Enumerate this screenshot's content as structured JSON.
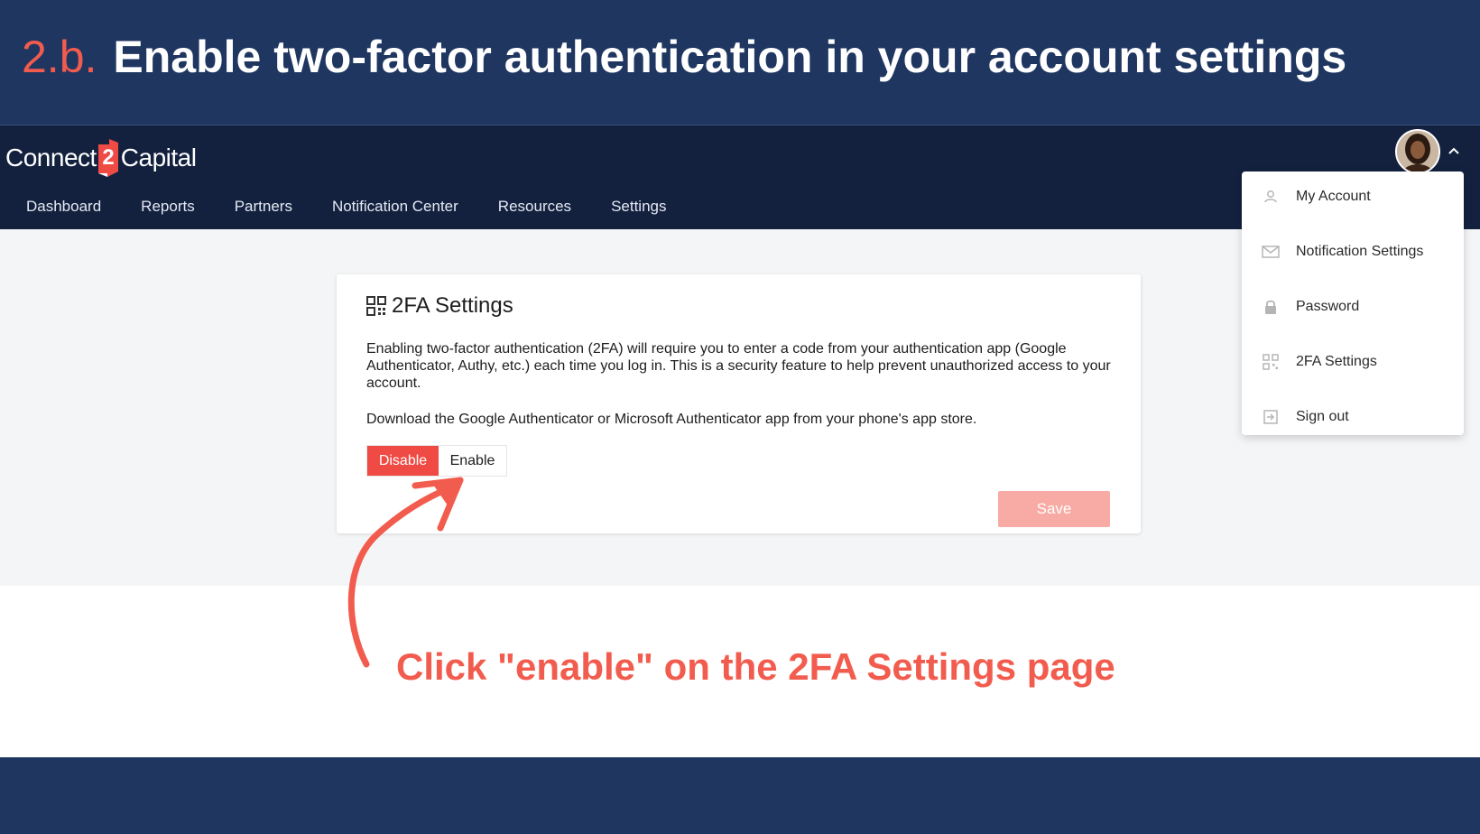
{
  "slide": {
    "step_number": "2.b.",
    "title": "Enable two-factor authentication in your account settings",
    "callout": "Click \"enable\" on the 2FA Settings page"
  },
  "app": {
    "logo": {
      "left": "Connect",
      "mark": "2",
      "right": "Capital"
    },
    "nav": [
      "Dashboard",
      "Reports",
      "Partners",
      "Notification Center",
      "Resources",
      "Settings"
    ],
    "user_menu": {
      "items": [
        {
          "label": "My Account",
          "icon": "user-icon"
        },
        {
          "label": "Notification Settings",
          "icon": "envelope-icon"
        },
        {
          "label": "Password",
          "icon": "lock-icon"
        },
        {
          "label": "2FA Settings",
          "icon": "qr-code-icon"
        },
        {
          "label": "Sign out",
          "icon": "sign-out-icon"
        }
      ]
    },
    "card": {
      "title": "2FA Settings",
      "description": "Enabling two-factor authentication (2FA) will require you to enter a code from your authentication app (Google Authenticator, Authy, etc.) each time you log in. This is a security feature to help prevent unauthorized access to your account.",
      "download_note": "Download the Google Authenticator or Microsoft Authenticator app from your phone's app store.",
      "toggle": {
        "disable_label": "Disable",
        "enable_label": "Enable",
        "selected": "Disable"
      },
      "save_label": "Save"
    }
  },
  "colors": {
    "slide_bg": "#1f3661",
    "topbar_bg": "#13213f",
    "accent": "#f25c4e",
    "disable_btn": "#ef4a44",
    "save_btn_disabled": "#f8aaa4"
  }
}
